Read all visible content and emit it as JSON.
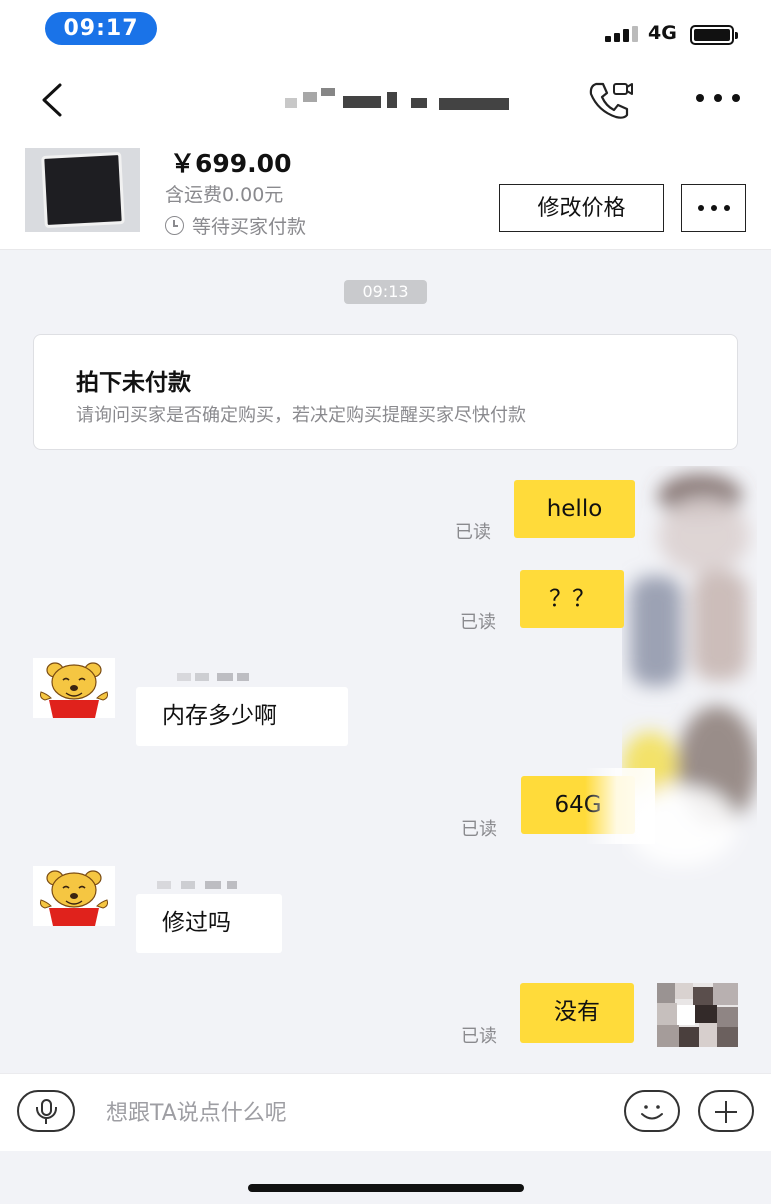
{
  "status_bar": {
    "time": "09:17",
    "network": "4G"
  },
  "header": {
    "icons": [
      "back-icon",
      "video-call-icon",
      "more-icon"
    ]
  },
  "product": {
    "price": "￥699.00",
    "shipping": "含运费0.00元",
    "status": "等待买家付款",
    "edit_price_label": "修改价格"
  },
  "chat": {
    "timestamp": "09:13",
    "notice": {
      "title": "拍下未付款",
      "description": "请询问买家是否确定购买，若决定购买提醒买家尽快付款"
    },
    "messages": [
      {
        "from": "me",
        "text": "hello",
        "status": "已读"
      },
      {
        "from": "me",
        "text": "？？",
        "status": "已读"
      },
      {
        "from": "other",
        "text": "内存多少啊"
      },
      {
        "from": "me",
        "text": "64G",
        "status": "已读"
      },
      {
        "from": "other",
        "text": "修过吗"
      },
      {
        "from": "me",
        "text": "没有",
        "status": "已读"
      }
    ]
  },
  "input_bar": {
    "placeholder": "想跟TA说点什么呢"
  },
  "colors": {
    "accent": "#1a73e8",
    "my_bubble": "#ffdb3a",
    "chat_bg": "#f2f3f7"
  }
}
